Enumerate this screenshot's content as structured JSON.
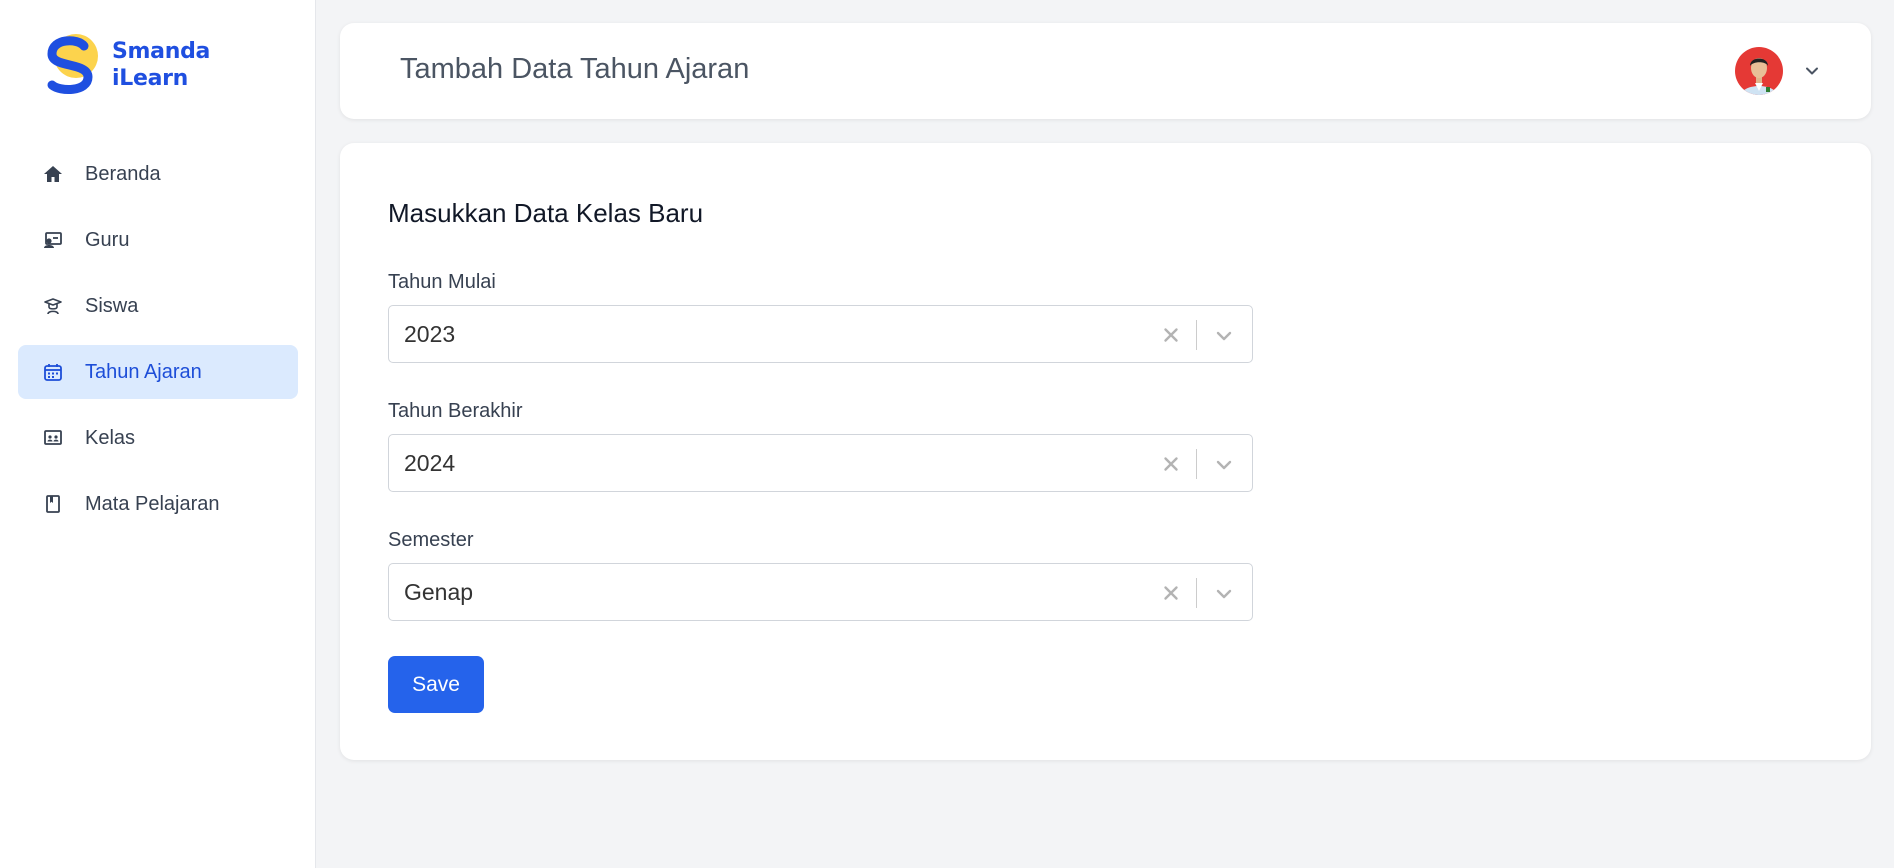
{
  "brand": {
    "line1": "Smanda",
    "line2": "iLearn"
  },
  "sidebar": {
    "items": [
      {
        "label": "Beranda",
        "icon": "home-icon"
      },
      {
        "label": "Guru",
        "icon": "teacher-icon"
      },
      {
        "label": "Siswa",
        "icon": "student-icon"
      },
      {
        "label": "Tahun Ajaran",
        "icon": "calendar-icon",
        "active": true
      },
      {
        "label": "Kelas",
        "icon": "classroom-icon"
      },
      {
        "label": "Mata Pelajaran",
        "icon": "book-icon"
      }
    ]
  },
  "header": {
    "title": "Tambah Data Tahun Ajaran"
  },
  "form": {
    "title": "Masukkan Data Kelas Baru",
    "fields": [
      {
        "label": "Tahun Mulai",
        "value": "2023"
      },
      {
        "label": "Tahun Berakhir",
        "value": "2024"
      },
      {
        "label": "Semester",
        "value": "Genap"
      }
    ],
    "save_label": "Save"
  },
  "colors": {
    "accent": "#2563eb",
    "active_bg": "#dbeafe",
    "brand_blue": "#1f4fe0",
    "brand_yellow": "#fcd34d",
    "background": "#f3f4f6"
  }
}
